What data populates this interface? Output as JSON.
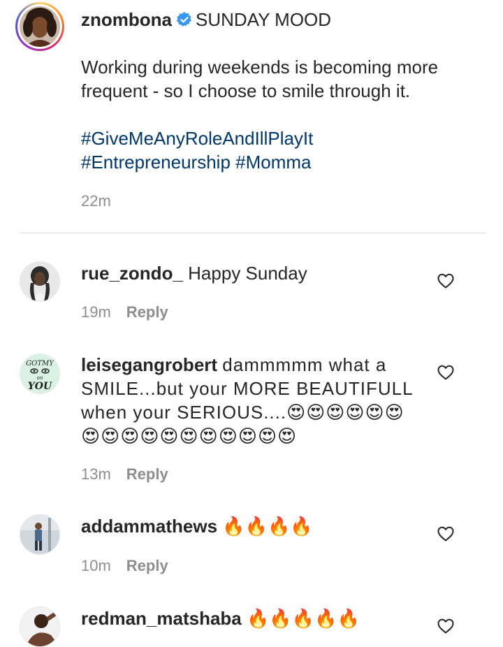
{
  "post": {
    "username": "znombona",
    "title": "SUNDAY MOOD",
    "caption": "Working during weekends is becoming more frequent - so I choose to smile through it.",
    "hashtags": [
      "#GiveMeAnyRoleAndIllPlayIt",
      "#Entrepreneurship",
      "#Momma"
    ],
    "time": "22m",
    "verified_icon": "verified-badge-icon"
  },
  "comments": [
    {
      "username": "rue_zondo_",
      "text": "Happy Sunday",
      "time": "19m",
      "reply_label": "Reply"
    },
    {
      "username": "leisegangrobert",
      "text": "dammmmm what a SMILE...but your MORE BEAUTIFULL when your SERIOUS....😍😍😍😍😍😍😍😍😍😍😍😍😍😍😍😍😍",
      "time": "13m",
      "reply_label": "Reply"
    },
    {
      "username": "addammathews",
      "text": "🔥🔥🔥🔥",
      "time": "10m",
      "reply_label": "Reply"
    },
    {
      "username": "redman_matshaba",
      "text": "🔥🔥🔥🔥🔥"
    }
  ],
  "avatar_badge_text": {
    "line1": "GOTMY",
    "line2": "on",
    "line3": "YOU"
  },
  "colors": {
    "text": "#262626",
    "muted": "#8e8e8e",
    "hashtag": "#00376b",
    "verified": "#3897f0",
    "divider": "#dbdbdb"
  }
}
